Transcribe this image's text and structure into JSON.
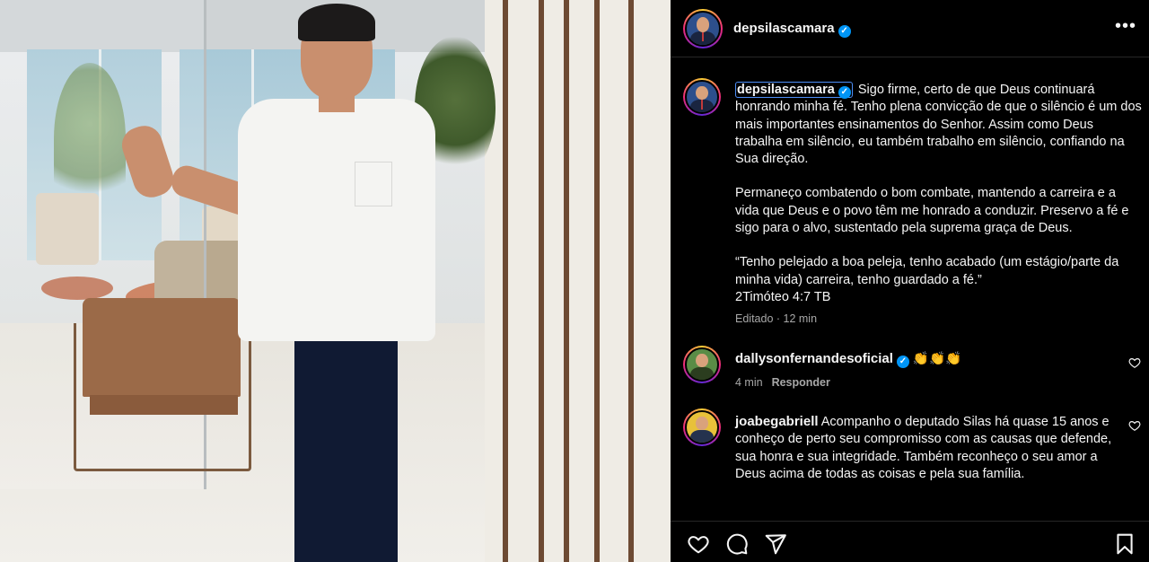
{
  "post": {
    "author": "depsilascamara",
    "more_label": "•••",
    "caption": {
      "author": "depsilascamara",
      "paragraphs": [
        "Sigo firme, certo de que Deus continuará honrando minha fé. Tenho plena convicção de que o silêncio é um dos mais importantes ensinamentos do Senhor. Assim como Deus trabalha em silêncio, eu também trabalho em silêncio, confiando na Sua direção.",
        "Permaneço combatendo o bom combate, mantendo a carreira e a vida que Deus e o povo têm me honrado a conduzir. Preservo a fé e sigo para o alvo, sustentado pela suprema graça de Deus.",
        "“Tenho pelejado a boa peleja, tenho acabado (um estágio/parte da minha vida) carreira, tenho guardado a fé.”"
      ],
      "reference": "2Timóteo 4:7 TB",
      "meta": "Editado · 12 min"
    }
  },
  "comments": [
    {
      "author": "dallysonfernandesoficial",
      "text": "👏👏👏",
      "time": "4 min",
      "reply_label": "Responder"
    },
    {
      "author": "joabegabriell",
      "text": "Acompanho o deputado Silas há quase 15 anos e conheço de perto seu compromisso com as causas que defende, sua honra e sua integridade. Também reconheço o seu amor a Deus acima de todas as coisas e pela sua família."
    }
  ],
  "icons": {
    "verified": "verified-badge-icon",
    "like": "heart-icon",
    "comment": "comment-icon",
    "share": "paper-plane-icon",
    "save": "bookmark-icon"
  },
  "colors": {
    "background": "#000000",
    "text": "#f5f5f5",
    "muted": "#a8a8a8",
    "verified": "#0095f6"
  }
}
